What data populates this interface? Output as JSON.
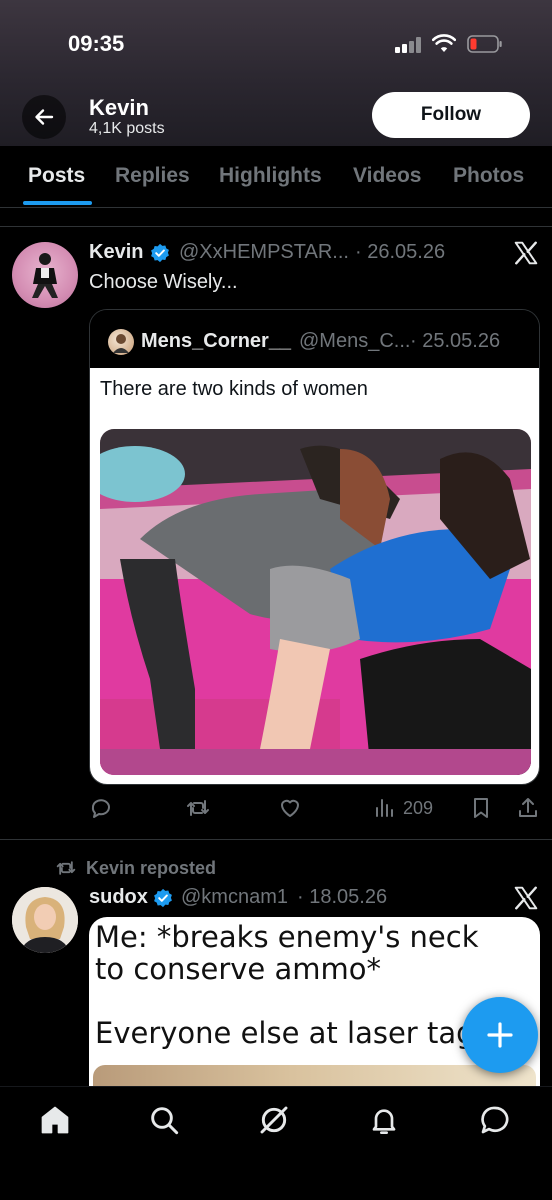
{
  "status_bar": {
    "time": "09:35"
  },
  "header": {
    "name": "Kevin",
    "post_count": "4,1K posts",
    "follow_label": "Follow"
  },
  "tabs": [
    {
      "label": "Posts",
      "active": true
    },
    {
      "label": "Replies"
    },
    {
      "label": "Highlights"
    },
    {
      "label": "Videos"
    },
    {
      "label": "Photos"
    }
  ],
  "post1": {
    "author": "Kevin",
    "handle": "@XxHEMPSTAR...",
    "date": "· 26.05.26",
    "text": "Choose Wisely...",
    "quote": {
      "author": "Mens_Corner__",
      "handle": "@Mens_C...",
      "date": "· 25.05.26",
      "text": "There are two kinds of women"
    },
    "stats": {
      "views": "209"
    }
  },
  "post2": {
    "repost_label": "Kevin reposted",
    "author": "sudox",
    "handle": "@kmcnam1",
    "date": "· 18.05.26",
    "meme_lines": [
      "Me: *breaks enemy's neck",
      "to conserve ammo*",
      "Everyone else at laser tag:"
    ]
  },
  "colors": {
    "accent": "#1d9bf0",
    "background": "#000000",
    "muted": "#71767b"
  },
  "icons": [
    "back-arrow-icon",
    "verified-badge-icon",
    "x-logo-icon",
    "reply-icon",
    "repost-icon",
    "like-icon",
    "views-icon",
    "bookmark-icon",
    "share-icon",
    "compose-plus-icon",
    "home-icon",
    "search-icon",
    "grok-icon",
    "notifications-icon",
    "messages-icon"
  ]
}
